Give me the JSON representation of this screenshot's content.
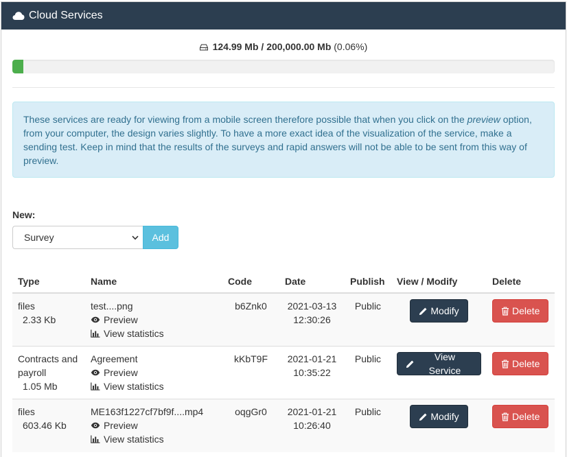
{
  "header": {
    "title": "Cloud Services",
    "icon": "cloud-icon"
  },
  "storage": {
    "used": "124.99 Mb",
    "separator": "/",
    "total": "200,000.00 Mb",
    "percent_text": "(0.06%)",
    "progress_percent": 0.06
  },
  "notice": {
    "before": "These services are ready for viewing from a mobile screen therefore possible that when you click on the ",
    "emphasis": "preview",
    "after": " option, from your computer, the design varies slightly. To have a more exact idea of the visualization of the service, make a sending test. Keep in mind that the results of the surveys and rapid answers will not be able to be sent from this way of preview."
  },
  "new_service": {
    "label": "New:",
    "selected": "Survey",
    "add_label": "Add"
  },
  "table": {
    "headers": [
      "Type",
      "Name",
      "Code",
      "Date",
      "Publish",
      "View / Modify",
      "Delete"
    ],
    "preview_label": "Preview",
    "stats_label": "View statistics",
    "delete_label": "Delete",
    "rows": [
      {
        "type": "files",
        "size": "2.33 Kb",
        "name": "test....png",
        "code": "b6Znk0",
        "date": "2021-03-13",
        "time": "12:30:26",
        "publish": "Public",
        "action": "Modify"
      },
      {
        "type": "Contracts and payroll",
        "size": "1.05 Mb",
        "name": "Agreement",
        "code": "kKbT9F",
        "date": "2021-01-21",
        "time": "10:35:22",
        "publish": "Public",
        "action": "View Service"
      },
      {
        "type": "files",
        "size": "603.46 Kb",
        "name": "ME163f1227cf7bf9f....mp4",
        "code": "oqgGr0",
        "date": "2021-01-21",
        "time": "10:26:40",
        "publish": "Public",
        "action": "Modify"
      }
    ]
  },
  "colors": {
    "header_bg": "#2c3e50",
    "progress": "#4cae4c",
    "info_bg": "#d9edf7",
    "delete": "#d9534f",
    "add": "#5bc0de"
  }
}
